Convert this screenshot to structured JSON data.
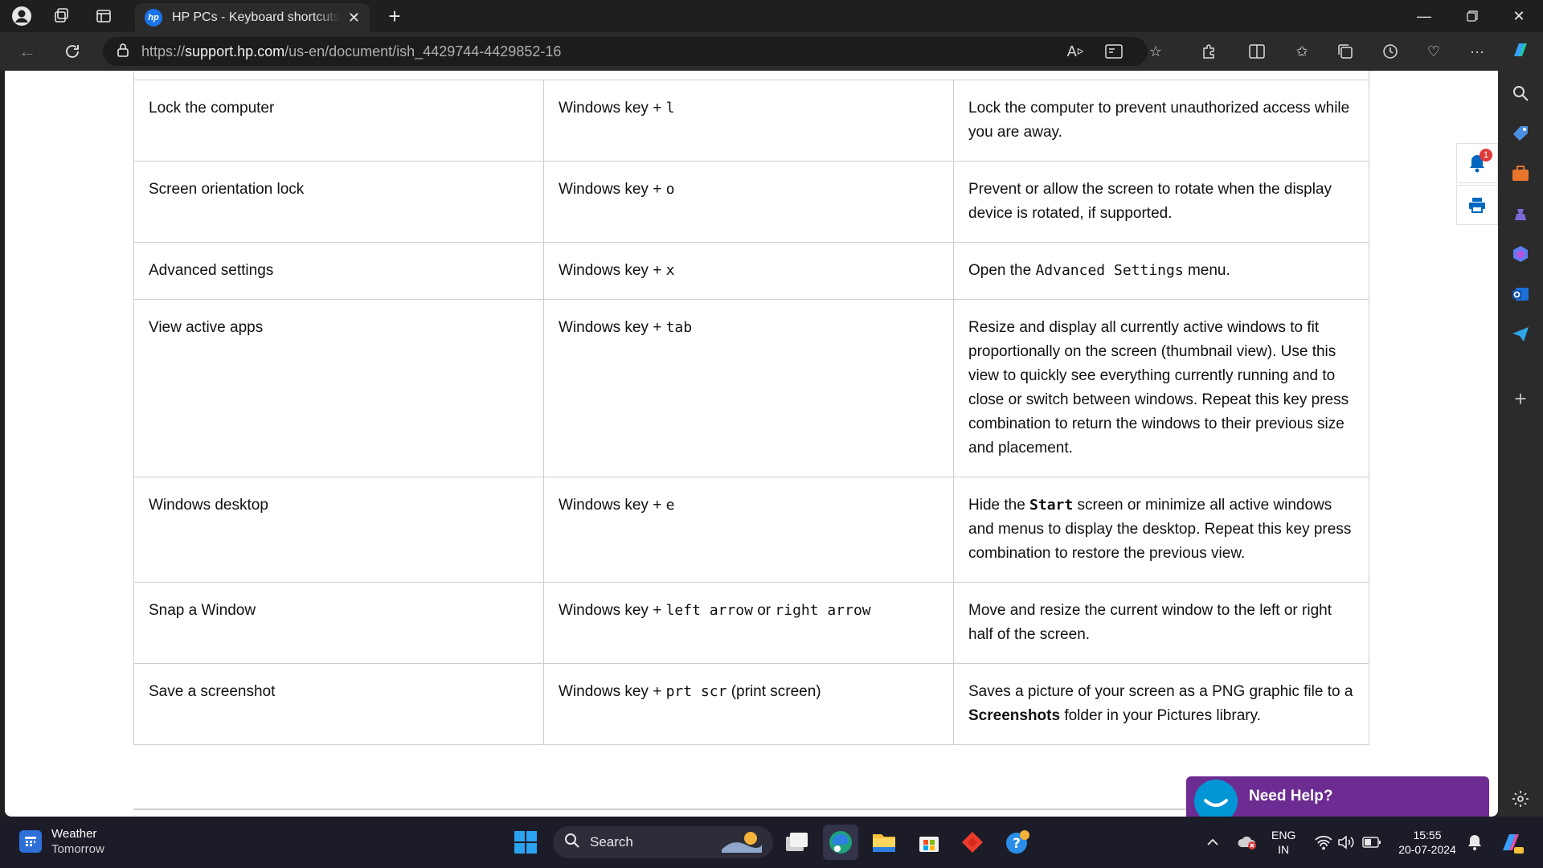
{
  "browser": {
    "tab_title": "HP PCs - Keyboard shortcuts, hotkeys",
    "tab_logo": "hp",
    "url_prefix": "https://",
    "url_domain": "support.hp.com",
    "url_path": "/us-en/document/ish_4429744-4429852-16"
  },
  "table": {
    "rows": [
      {
        "action": "Lock the computer",
        "keys": [
          {
            "t": "Windows key"
          },
          {
            "t": " + "
          },
          {
            "t": "l",
            "mono": true
          }
        ],
        "desc": [
          {
            "t": "Lock the computer to prevent unauthorized access while you are away."
          }
        ]
      },
      {
        "action": "Screen orientation lock",
        "keys": [
          {
            "t": "Windows key"
          },
          {
            "t": " + "
          },
          {
            "t": "o",
            "mono": true
          }
        ],
        "desc": [
          {
            "t": "Prevent or allow the screen to rotate when the display device is rotated, if supported."
          }
        ]
      },
      {
        "action": "Advanced settings",
        "keys": [
          {
            "t": "Windows key"
          },
          {
            "t": " + "
          },
          {
            "t": "x",
            "mono": true
          }
        ],
        "desc": [
          {
            "t": "Open the "
          },
          {
            "t": "Advanced Settings",
            "mono": true
          },
          {
            "t": " menu."
          }
        ]
      },
      {
        "action": "View active apps",
        "keys": [
          {
            "t": "Windows key"
          },
          {
            "t": " + "
          },
          {
            "t": "tab",
            "mono": true
          }
        ],
        "desc": [
          {
            "t": "Resize and display all currently active windows to fit proportionally on the screen (thumbnail view). Use this view to quickly see everything currently running and to close or switch between windows. Repeat this key press combination to return the windows to their previous size and placement."
          }
        ]
      },
      {
        "action": "Windows desktop",
        "keys": [
          {
            "t": "Windows key"
          },
          {
            "t": " + "
          },
          {
            "t": "e",
            "mono": true
          }
        ],
        "desc": [
          {
            "t": "Hide the "
          },
          {
            "t": "Start",
            "mono": true,
            "bold": true
          },
          {
            "t": " screen or minimize all active windows and menus to display the desktop. Repeat this key press combination to restore the previous view."
          }
        ]
      },
      {
        "action": "Snap a Window",
        "keys": [
          {
            "t": "Windows key"
          },
          {
            "t": " + "
          },
          {
            "t": "left arrow",
            "mono": true
          },
          {
            "t": " or "
          },
          {
            "t": "right arrow",
            "mono": true
          }
        ],
        "desc": [
          {
            "t": "Move and resize the current window to the left or right half of the screen."
          }
        ]
      },
      {
        "action": "Save a screenshot",
        "keys": [
          {
            "t": "Windows key"
          },
          {
            "t": " + "
          },
          {
            "t": "prt scr",
            "mono": true
          },
          {
            "t": " (print screen)"
          }
        ],
        "desc": [
          {
            "t": "Saves a picture of your screen as a PNG graphic file to a "
          },
          {
            "t": "Screenshots",
            "bold": true
          },
          {
            "t": " folder in your Pictures library."
          }
        ]
      }
    ]
  },
  "widgets": {
    "notification_count": "1",
    "need_help_label": "Need Help?"
  },
  "taskbar": {
    "weather_title": "Weather",
    "weather_sub": "Tomorrow",
    "search_label": "Search",
    "lang_top": "ENG",
    "lang_bottom": "IN",
    "time": "15:55",
    "date": "20-07-2024"
  },
  "colors": {
    "hp_blue": "#0096d6",
    "need_help_purple": "#6c2c91",
    "taskbar_bg": "#1c1c28"
  }
}
